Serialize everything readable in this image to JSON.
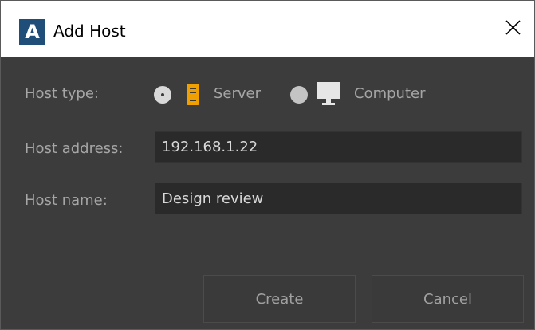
{
  "window": {
    "title": "Add Host",
    "logo_letter": "A",
    "close_glyph": "✕"
  },
  "form": {
    "host_type": {
      "label": "Host type:",
      "options": [
        {
          "label": "Server",
          "icon": "server-icon",
          "selected": true
        },
        {
          "label": "Computer",
          "icon": "monitor-icon",
          "selected": false
        }
      ]
    },
    "host_address": {
      "label": "Host address:",
      "value": "192.168.1.22",
      "placeholder": ""
    },
    "host_name": {
      "label": "Host name:",
      "value": "Design review",
      "placeholder": ""
    }
  },
  "buttons": {
    "create": "Create",
    "cancel": "Cancel"
  },
  "colors": {
    "background": "#3c3c3c",
    "titlebar": "#ffffff",
    "logo": "#1f4e79",
    "server_icon": "#f0a000",
    "text_muted": "#a6a6a6",
    "field_bg": "#2a2a2a"
  }
}
